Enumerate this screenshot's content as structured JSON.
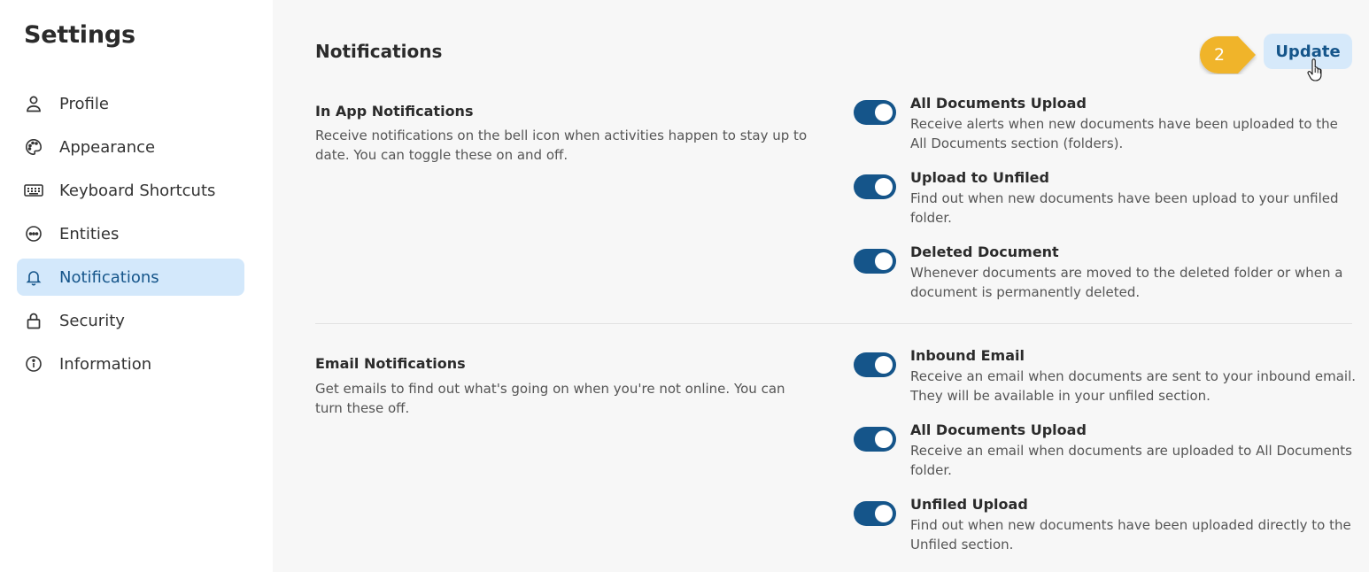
{
  "sidebar": {
    "title": "Settings",
    "items": [
      {
        "label": "Profile",
        "icon": "user-icon"
      },
      {
        "label": "Appearance",
        "icon": "palette-icon"
      },
      {
        "label": "Keyboard Shortcuts",
        "icon": "keyboard-icon"
      },
      {
        "label": "Entities",
        "icon": "dots-circle-icon"
      },
      {
        "label": "Notifications",
        "icon": "bell-icon",
        "active": true
      },
      {
        "label": "Security",
        "icon": "lock-icon"
      },
      {
        "label": "Information",
        "icon": "info-icon"
      }
    ]
  },
  "main": {
    "title": "Notifications",
    "update_label": "Update",
    "step_badge": "2",
    "sections": [
      {
        "heading": "In App Notifications",
        "description": "Receive notifications on the bell icon when activities happen to stay up to date. You can toggle these on and off.",
        "settings": [
          {
            "title": "All Documents Upload",
            "description": "Receive alerts when new documents have been uploaded to the All Documents section (folders).",
            "enabled": true
          },
          {
            "title": "Upload to Unfiled",
            "description": "Find out when new documents have been upload to your unfiled folder.",
            "enabled": true
          },
          {
            "title": "Deleted Document",
            "description": "Whenever documents are moved to the deleted folder or when a document is permanently deleted.",
            "enabled": true
          }
        ]
      },
      {
        "heading": "Email Notifications",
        "description": "Get emails to find out what's going on when you're not online. You can turn these off.",
        "settings": [
          {
            "title": "Inbound Email",
            "description": "Receive an email when documents are sent to your inbound email. They will be available in your unfiled section.",
            "enabled": true
          },
          {
            "title": "All Documents Upload",
            "description": "Receive an email when documents are uploaded to All Documents folder.",
            "enabled": true
          },
          {
            "title": "Unfiled Upload",
            "description": "Find out when new documents have been uploaded directly to the Unfiled section.",
            "enabled": true
          }
        ]
      }
    ]
  },
  "colors": {
    "accent": "#15558a",
    "active_bg": "#d3e8fb",
    "badge": "#f0b429"
  }
}
